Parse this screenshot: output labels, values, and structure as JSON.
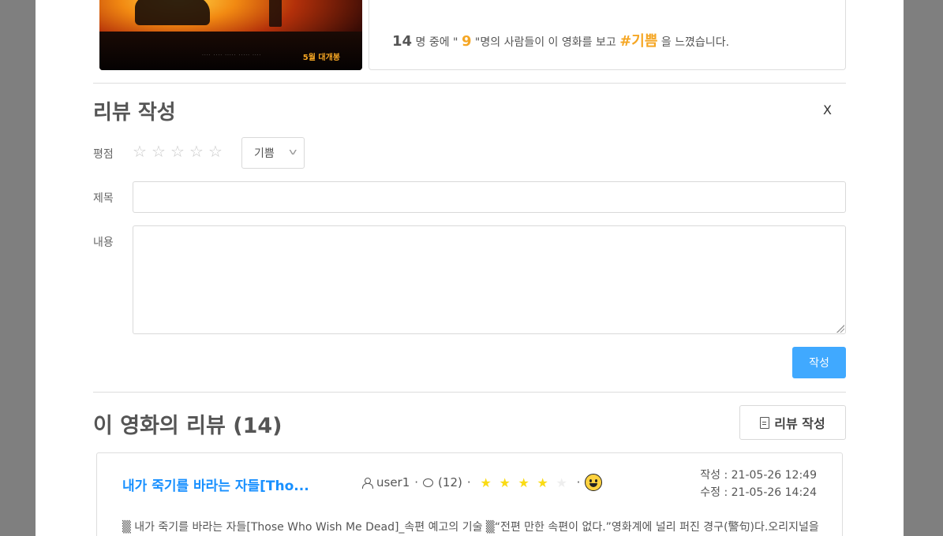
{
  "movie": {
    "poster_release_text": "5월 대개봉",
    "poster_credits_text": "···· ···· ····· ····· ····"
  },
  "emotion_summary": {
    "total": "14",
    "text_1": " 명 중에 \" ",
    "count": "9",
    "text_2": " \"명의 사람들이 이 영화를 보고 ",
    "emotion_tag": "#기쁨",
    "text_3": " 을 느꼈습니다."
  },
  "review_form": {
    "title": "리뷰 작성",
    "close_label": "X",
    "rating_label": "평점",
    "star_glyph": "☆",
    "emotion_selected": "기쁨",
    "subject_label": "제목",
    "subject_value": "",
    "content_label": "내용",
    "content_value": "",
    "submit_label": "작성"
  },
  "reviews": {
    "heading": "이 영화의 리뷰 (14)",
    "write_button_label": "리뷰 작성",
    "items": [
      {
        "title": "내가 죽기를 바라는 자들[Tho...",
        "user": "user1",
        "comments": "(12)",
        "rating": 4,
        "rating_max": 5,
        "emotion_icon": "grinning-face",
        "created": "작성 : 21-05-26 12:49",
        "updated": "수정 : 21-05-26 14:24",
        "excerpt": "▒ 내가 죽기를 바라는 자들[Those Who Wish Me Dead]_속편 예고의 기술 ▒“전편 만한 속편이 없다.”영화계에 널리 퍼진 경구(警句)다.오리지널을"
      }
    ]
  },
  "colors": {
    "accent_blue": "#1890ff",
    "button_blue": "#40a9ff",
    "emotion_orange": "#f5a623",
    "star_yellow": "#fadb14",
    "overlay": "#7f7f7f"
  }
}
